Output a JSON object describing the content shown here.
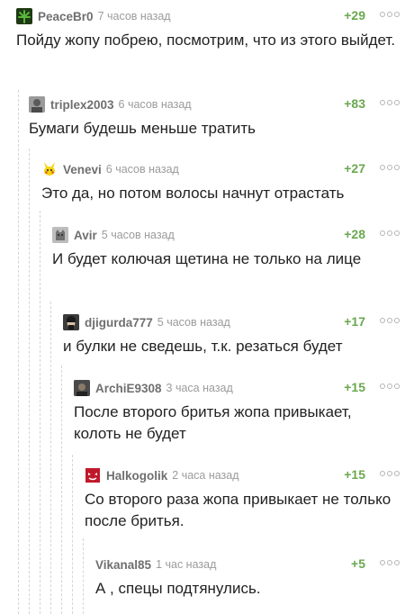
{
  "comments": [
    {
      "user": "PeaceBr0",
      "time": "7 часов назад",
      "rating": "+29",
      "avatar_icon": "cannabis-leaf-icon",
      "text": "Пойду жопу побрею, посмотрим, что из этого выйдет."
    },
    {
      "user": "triplex2003",
      "time": "6 часов назад",
      "rating": "+83",
      "avatar_icon": "user-photo-avatar",
      "text": "Бумаги будешь меньше тратить"
    },
    {
      "user": "Venevi",
      "time": "6 часов назад",
      "rating": "+27",
      "avatar_icon": "pikachu-avatar",
      "text": "Это да, но потом волосы начнут отрастать"
    },
    {
      "user": "Avir",
      "time": "5 часов назад",
      "rating": "+28",
      "avatar_icon": "cat-avatar",
      "text": "И будет колючая щетина не только на лице"
    },
    {
      "user": "djigurda777",
      "time": "5 часов назад",
      "rating": "+17",
      "avatar_icon": "portrait-avatar",
      "text": "и булки не сведешь, т.к. резаться будет"
    },
    {
      "user": "ArchiE9308",
      "time": "3 часа назад",
      "rating": "+15",
      "avatar_icon": "dark-photo-avatar",
      "text": "После второго бритья жопа привыкает, колоть не будет"
    },
    {
      "user": "Halkogolik",
      "time": "2 часа назад",
      "rating": "+15",
      "avatar_icon": "red-mask-avatar",
      "text": "Со второго раза жопа привыкает не только после бритья."
    },
    {
      "user": "Vikanal85",
      "time": "1 час назад",
      "rating": "+5",
      "avatar_icon": "",
      "text": "А , спецы подтянулись."
    }
  ],
  "colors": {
    "rating": "#6aa84f",
    "username": "#6f6f6f",
    "time": "#9b9b9b",
    "text": "#222222",
    "thread_line": "#d6d6d6"
  }
}
